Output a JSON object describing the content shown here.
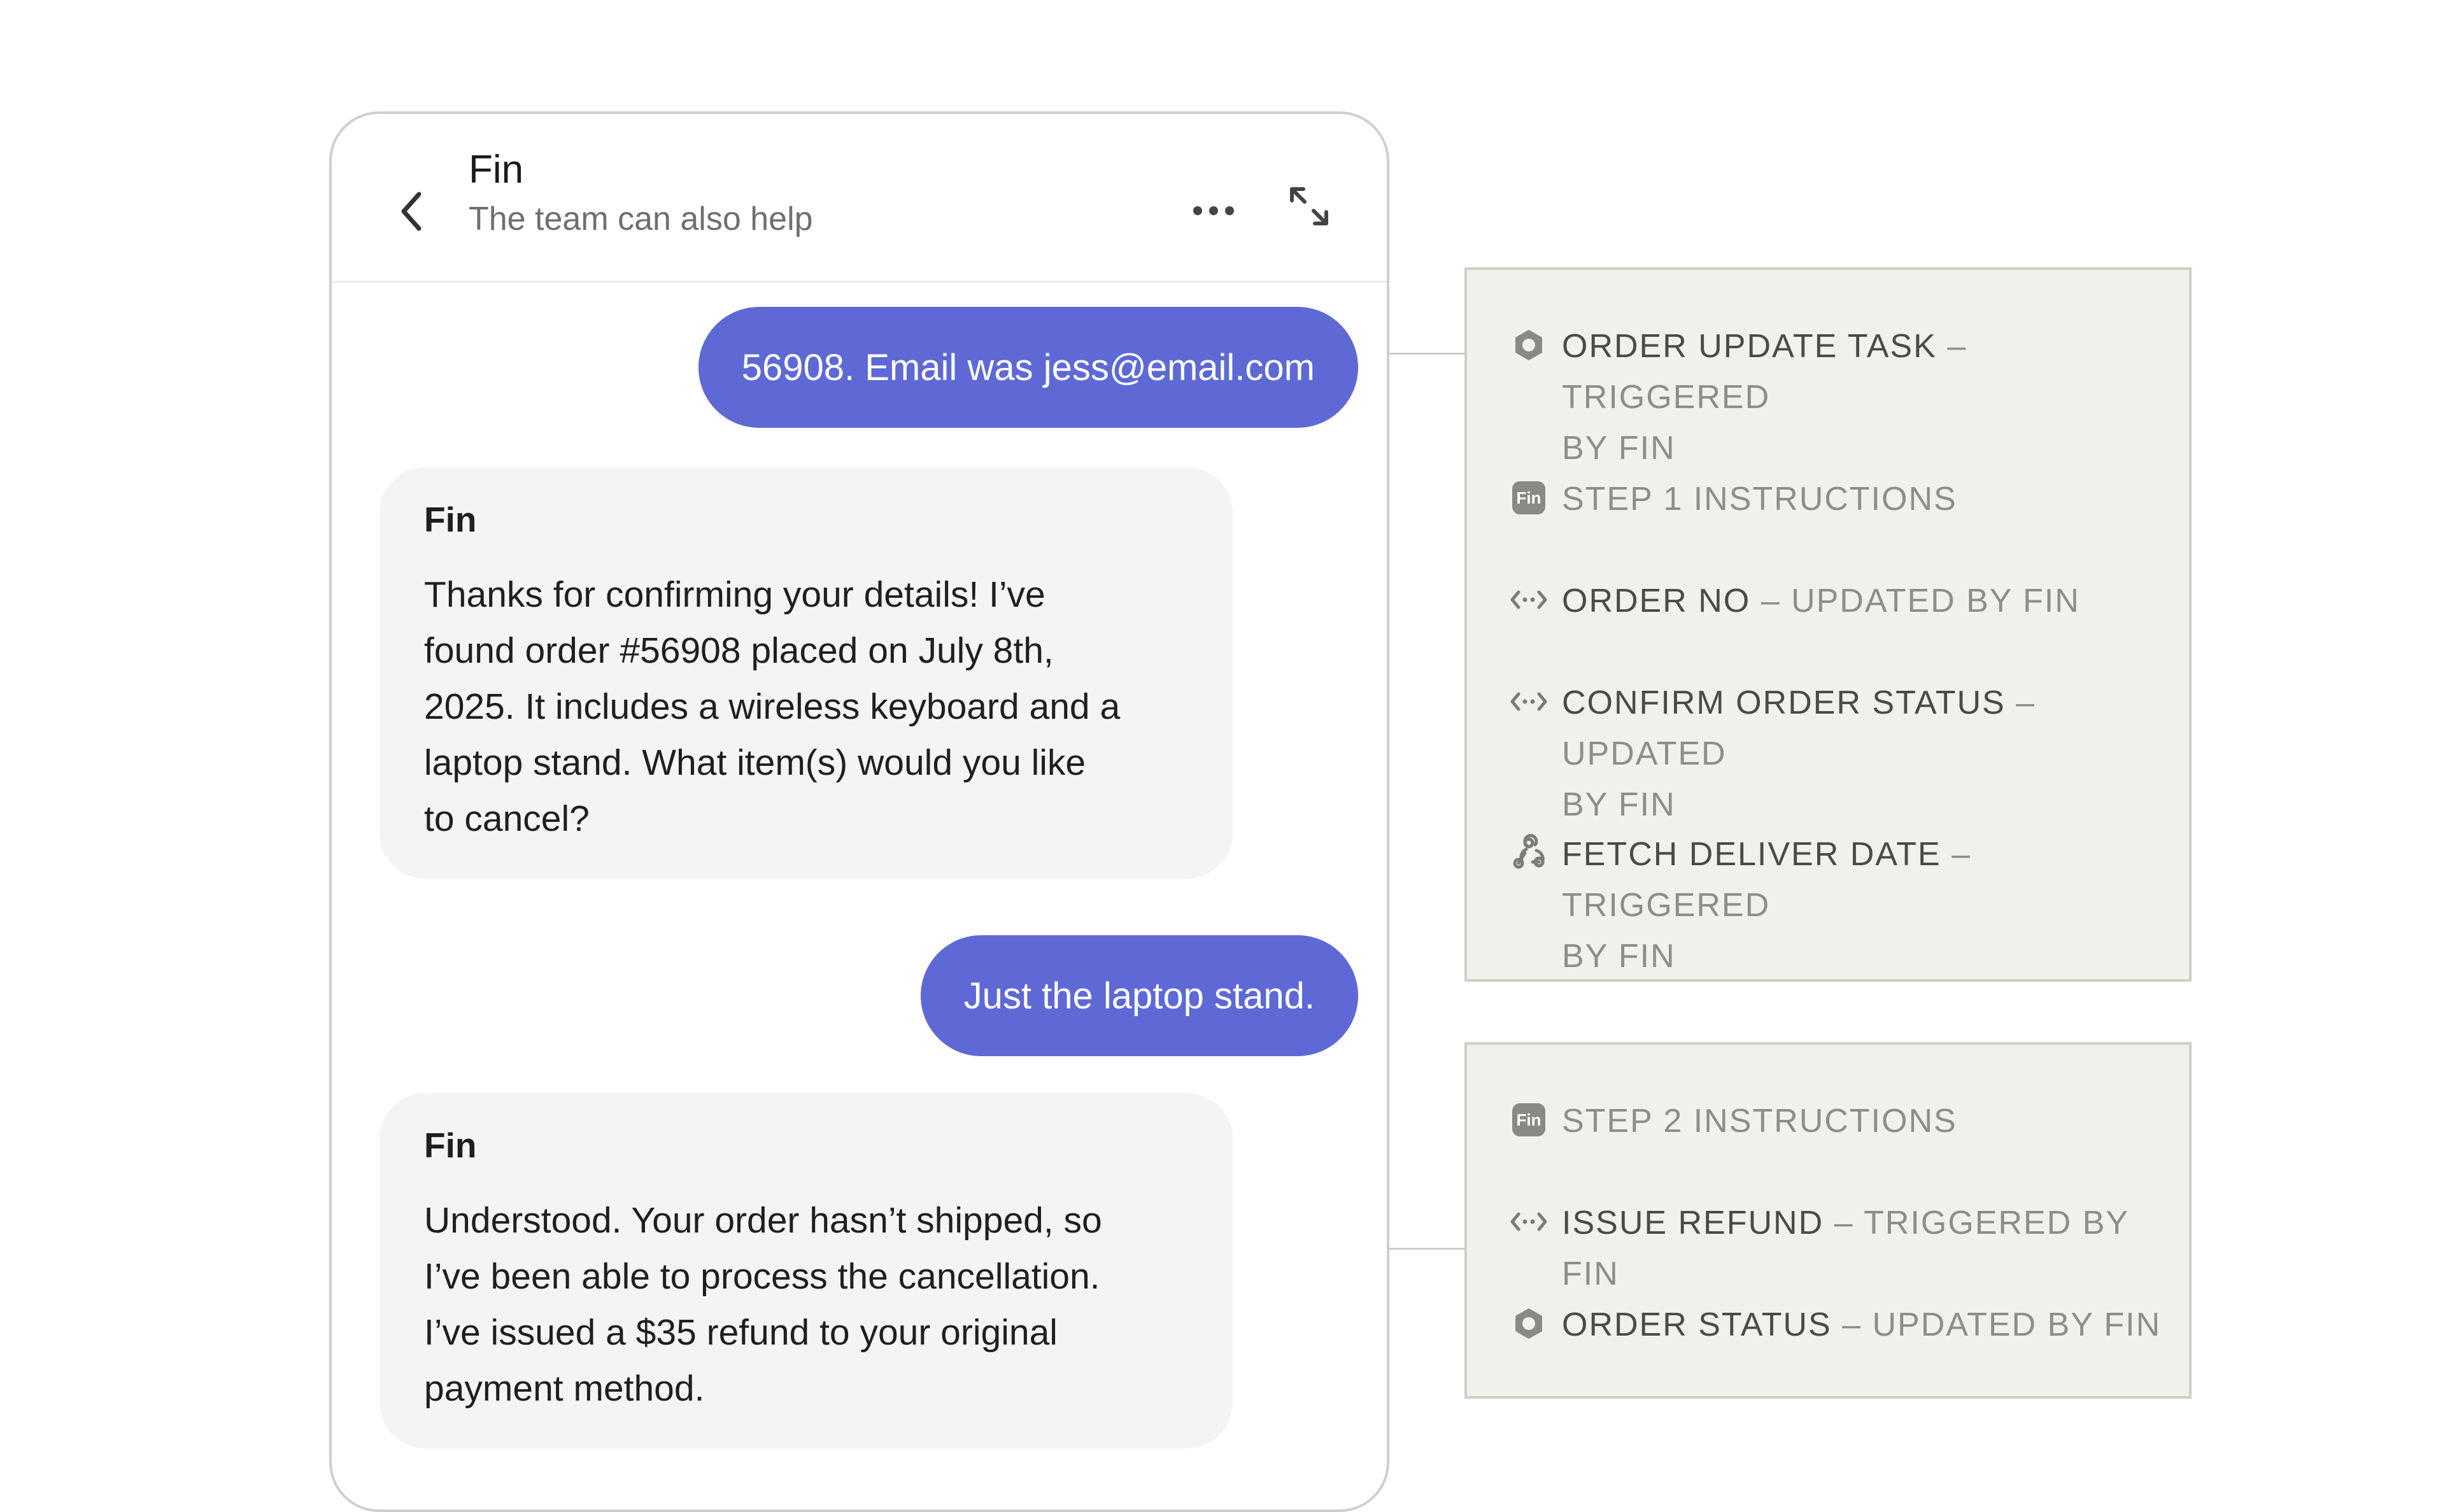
{
  "chat": {
    "header": {
      "title": "Fin",
      "subtitle": "The team can also help"
    },
    "messages": [
      {
        "role": "user",
        "text": "56908. Email was jess@email.com"
      },
      {
        "role": "bot",
        "name": "Fin",
        "lines": [
          "Thanks for confirming your details! I’ve",
          "found order #56908 placed on July 8th,",
          "2025. It includes a wireless keyboard and a",
          "laptop stand. What item(s) would you like",
          "to cancel?"
        ]
      },
      {
        "role": "user",
        "text": "Just the laptop stand."
      },
      {
        "role": "bot",
        "name": "Fin",
        "lines": [
          "Understood. Your order hasn’t shipped, so",
          "I’ve been able to process the cancellation.",
          "I’ve issued a $35 refund to your original",
          "payment method."
        ]
      }
    ],
    "colors": {
      "user_bubble": "#5e69d6",
      "bot_bubble": "#f4f4f4"
    }
  },
  "panels": [
    {
      "items": [
        {
          "icon": "hexagon-icon",
          "label": "ORDER UPDATE TASK",
          "status_line1": " – TRIGGERED",
          "status_line2": "BY FIN"
        },
        {
          "icon": "fin-icon",
          "label": "",
          "status_line1": "STEP 1 INSTRUCTIONS",
          "status_line2": ""
        },
        {
          "icon": "code-icon",
          "label": "ORDER NO",
          "status_line1": " – UPDATED BY FIN",
          "status_line2": ""
        },
        {
          "icon": "code-icon",
          "label": "CONFIRM ORDER STATUS",
          "status_line1": " – UPDATED",
          "status_line2": "BY FIN"
        },
        {
          "icon": "webhook-icon",
          "label": "FETCH DELIVER DATE",
          "status_line1": " – TRIGGERED",
          "status_line2": "BY FIN"
        }
      ]
    },
    {
      "items": [
        {
          "icon": "fin-icon",
          "label": "",
          "status_line1": "STEP 2 INSTRUCTIONS",
          "status_line2": ""
        },
        {
          "icon": "code-icon",
          "label": "ISSUE REFUND",
          "status_line1": " – TRIGGERED BY FIN",
          "status_line2": ""
        },
        {
          "icon": "hexagon-icon",
          "label": "ORDER STATUS",
          "status_line1": " – UPDATED BY FIN",
          "status_line2": ""
        }
      ]
    }
  ],
  "fin_badge_text": "Fin"
}
